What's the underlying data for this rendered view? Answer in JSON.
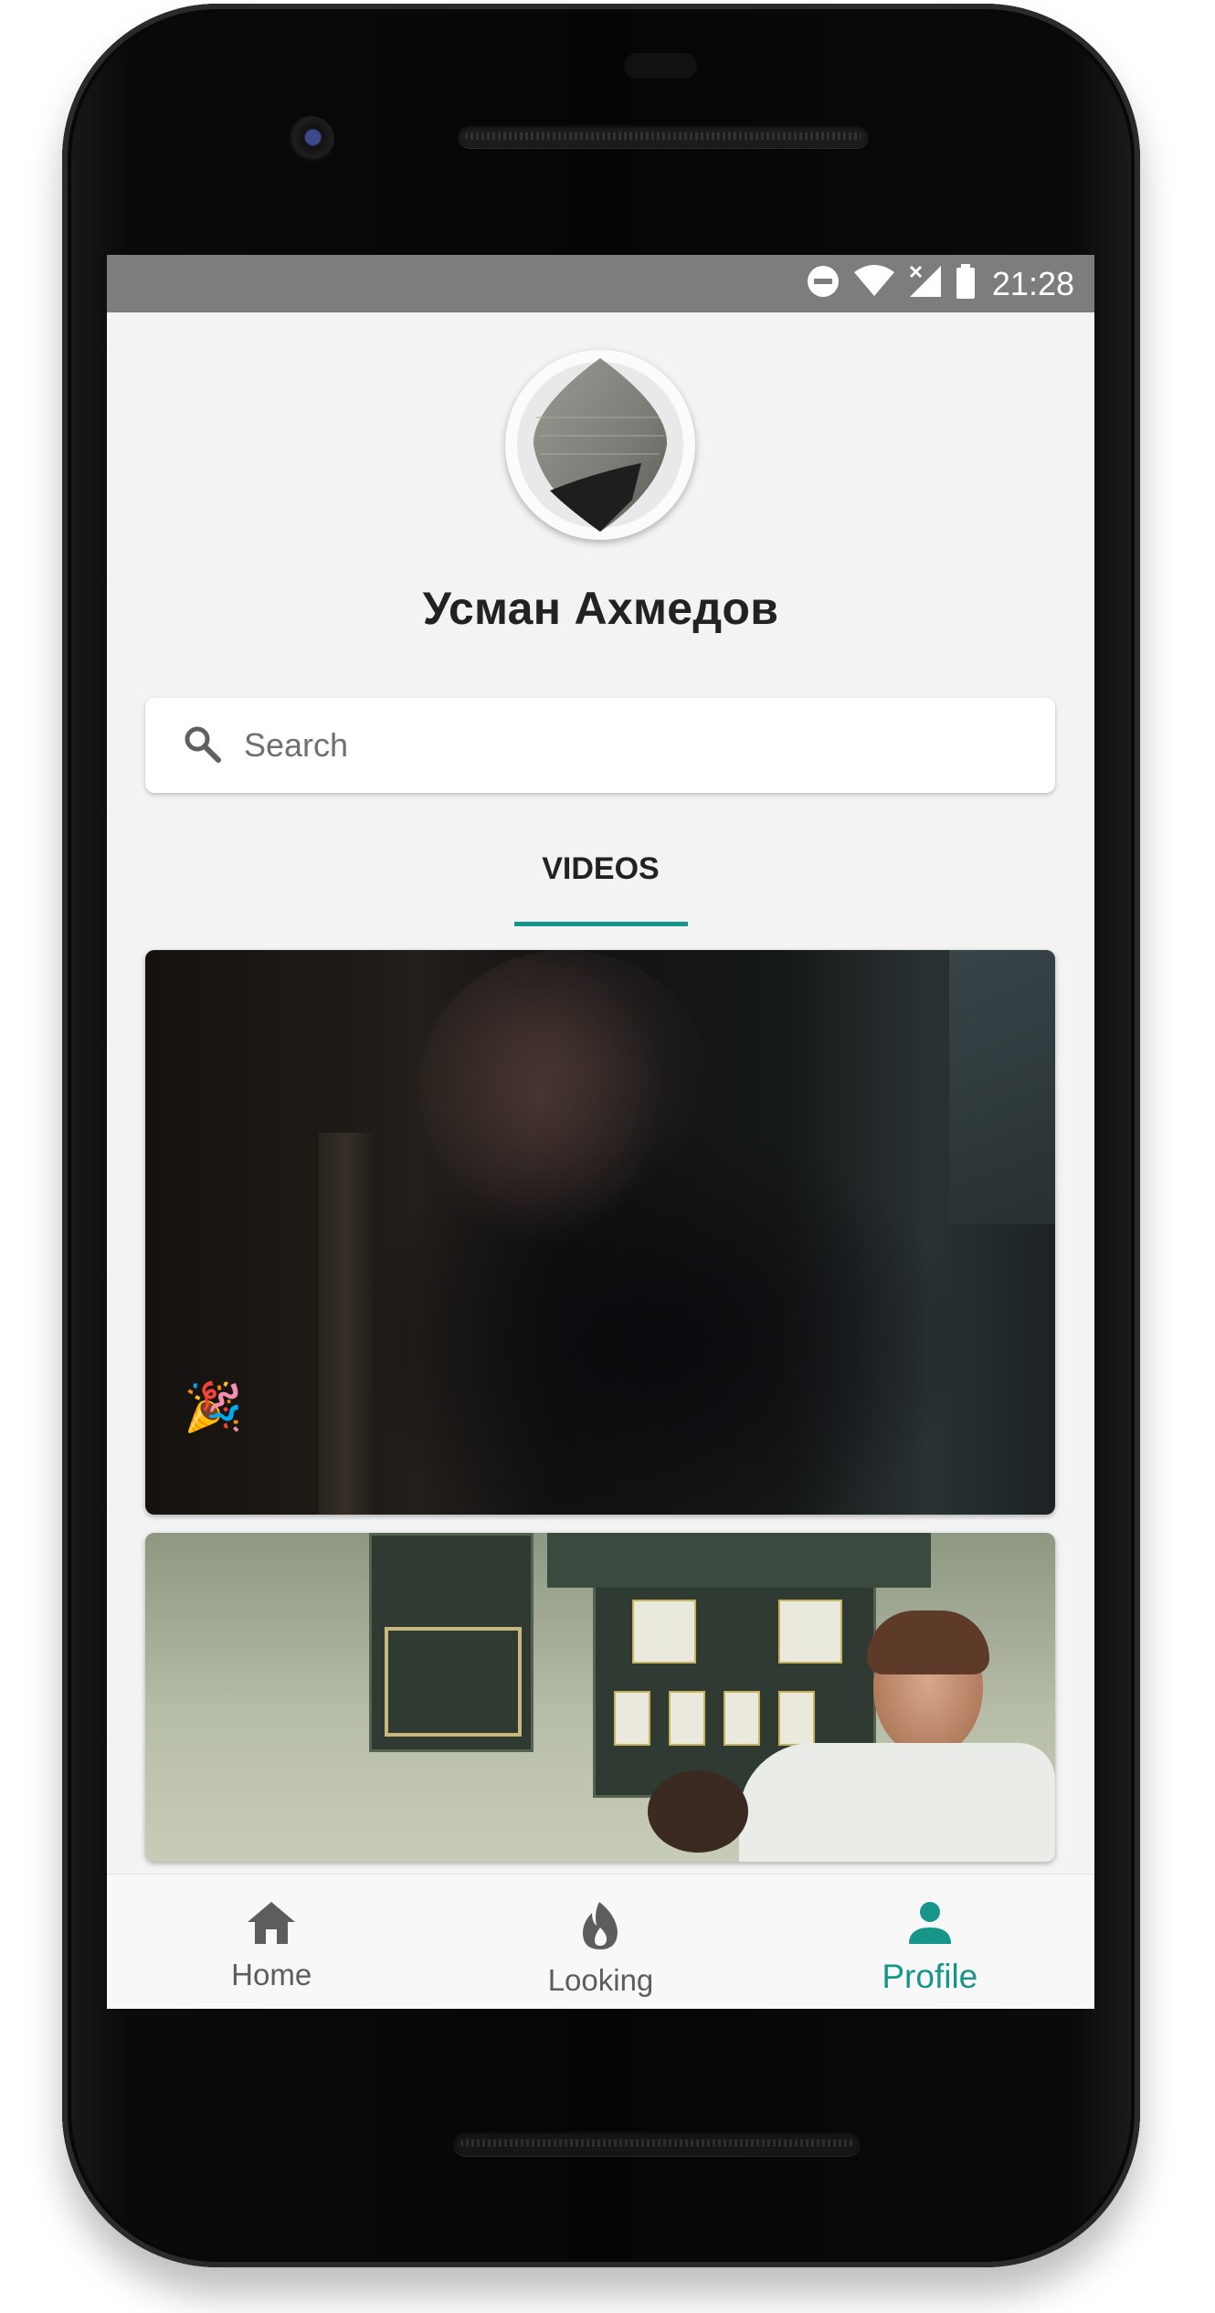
{
  "status_bar": {
    "time": "21:28",
    "icons": [
      "do-not-disturb-icon",
      "wifi-icon",
      "signal-off-icon",
      "battery-icon"
    ]
  },
  "profile": {
    "name": "Усман Ахмедов"
  },
  "search": {
    "placeholder": "Search",
    "value": ""
  },
  "tabs": [
    {
      "label": "VIDEOS",
      "active": true
    }
  ],
  "videos": [
    {
      "overlay_emoji": "🎉"
    },
    {
      "overlay_emoji": ""
    }
  ],
  "bottom_nav": {
    "items": [
      {
        "label": "Home",
        "icon": "home-icon",
        "active": false
      },
      {
        "label": "Looking",
        "icon": "flame-icon",
        "active": false
      },
      {
        "label": "Profile",
        "icon": "person-icon",
        "active": true
      }
    ]
  },
  "colors": {
    "accent": "#16968a",
    "status_bar": "#7d7d7d",
    "background": "#f3f3f3"
  }
}
